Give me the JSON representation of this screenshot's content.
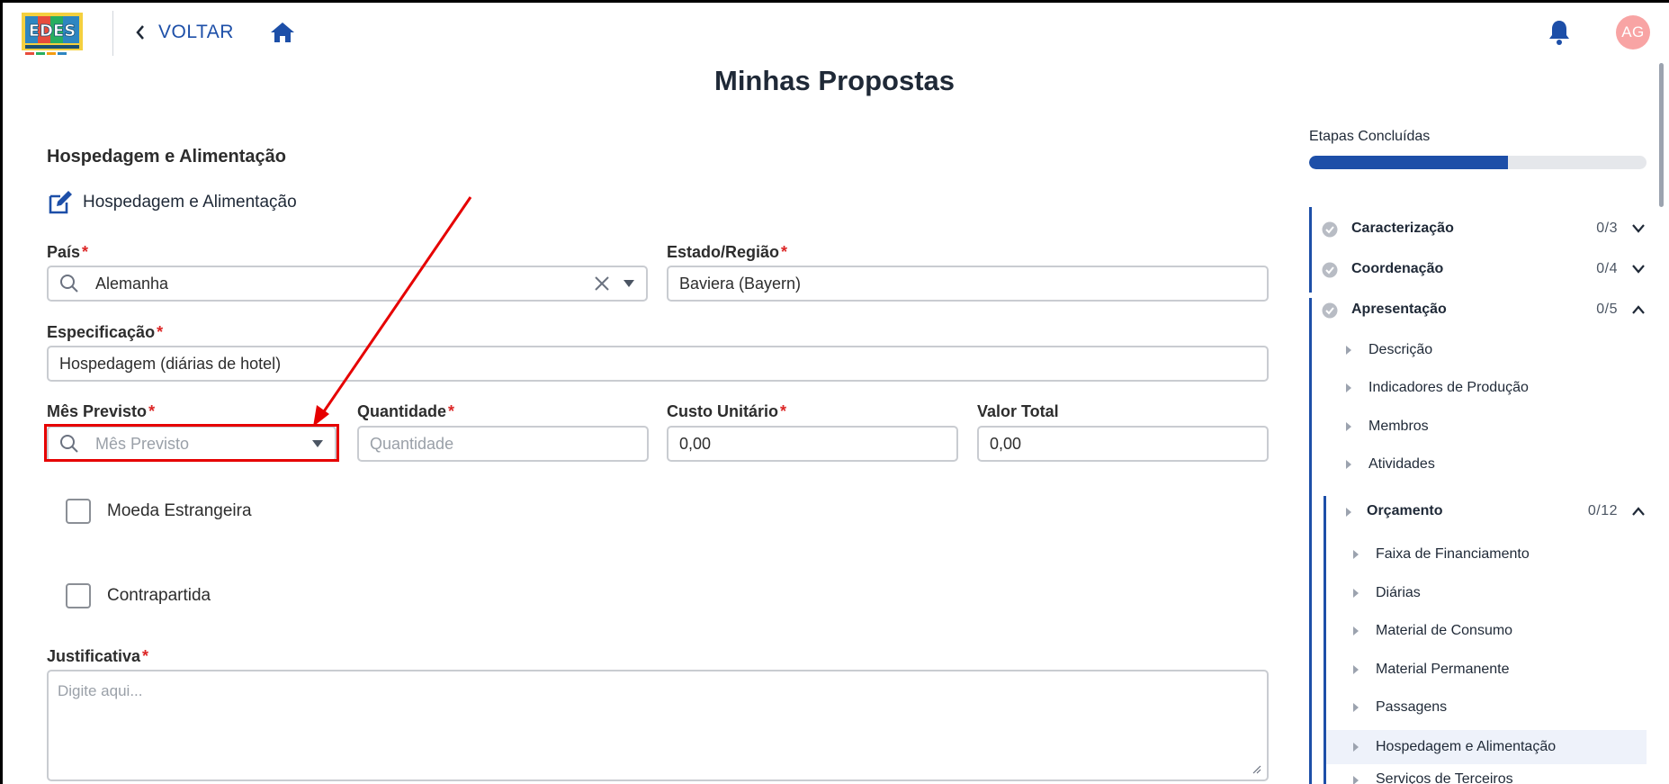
{
  "topbar": {
    "back_label": "VOLTAR",
    "avatar_initials": "AG",
    "brand_color": "#1d4fa8"
  },
  "page": {
    "title": "Minhas Propostas"
  },
  "form": {
    "section_title": "Hospedagem e Alimentação",
    "sub_header": "Hospedagem e Alimentação",
    "pais": {
      "label": "País",
      "value": "Alemanha"
    },
    "estado": {
      "label": "Estado/Região",
      "value": "Baviera (Bayern)"
    },
    "especificacao": {
      "label": "Especificação",
      "value": "Hospedagem (diárias de hotel)"
    },
    "mes_previsto": {
      "label": "Mês Previsto",
      "placeholder": "Mês Previsto"
    },
    "quantidade": {
      "label": "Quantidade",
      "placeholder": "Quantidade"
    },
    "custo_unitario": {
      "label": "Custo Unitário",
      "value": "0,00"
    },
    "valor_total": {
      "label": "Valor Total",
      "value": "0,00"
    },
    "moeda_estrangeira": {
      "label": "Moeda Estrangeira",
      "checked": false
    },
    "contrapartida": {
      "label": "Contrapartida",
      "checked": false
    },
    "justificativa": {
      "label": "Justificativa",
      "placeholder": "Digite aqui..."
    },
    "required_mark": "*"
  },
  "sidebar": {
    "title": "Etapas Concluídas",
    "progress_fraction": 0.59,
    "steps": [
      {
        "label": "Caracterização",
        "count": "0/3",
        "expanded": false
      },
      {
        "label": "Coordenação",
        "count": "0/4",
        "expanded": false
      },
      {
        "label": "Apresentação",
        "count": "0/5",
        "expanded": true
      }
    ],
    "apresentacao_items": [
      "Descrição",
      "Indicadores de Produção",
      "Membros",
      "Atividades"
    ],
    "orcamento": {
      "label": "Orçamento",
      "count": "0/12"
    },
    "orcamento_items": [
      "Faixa de Financiamento",
      "Diárias",
      "Material de Consumo",
      "Material Permanente",
      "Passagens",
      "Hospedagem e Alimentação",
      "Serviços de Terceiros"
    ],
    "active_item": "Hospedagem e Alimentação"
  }
}
